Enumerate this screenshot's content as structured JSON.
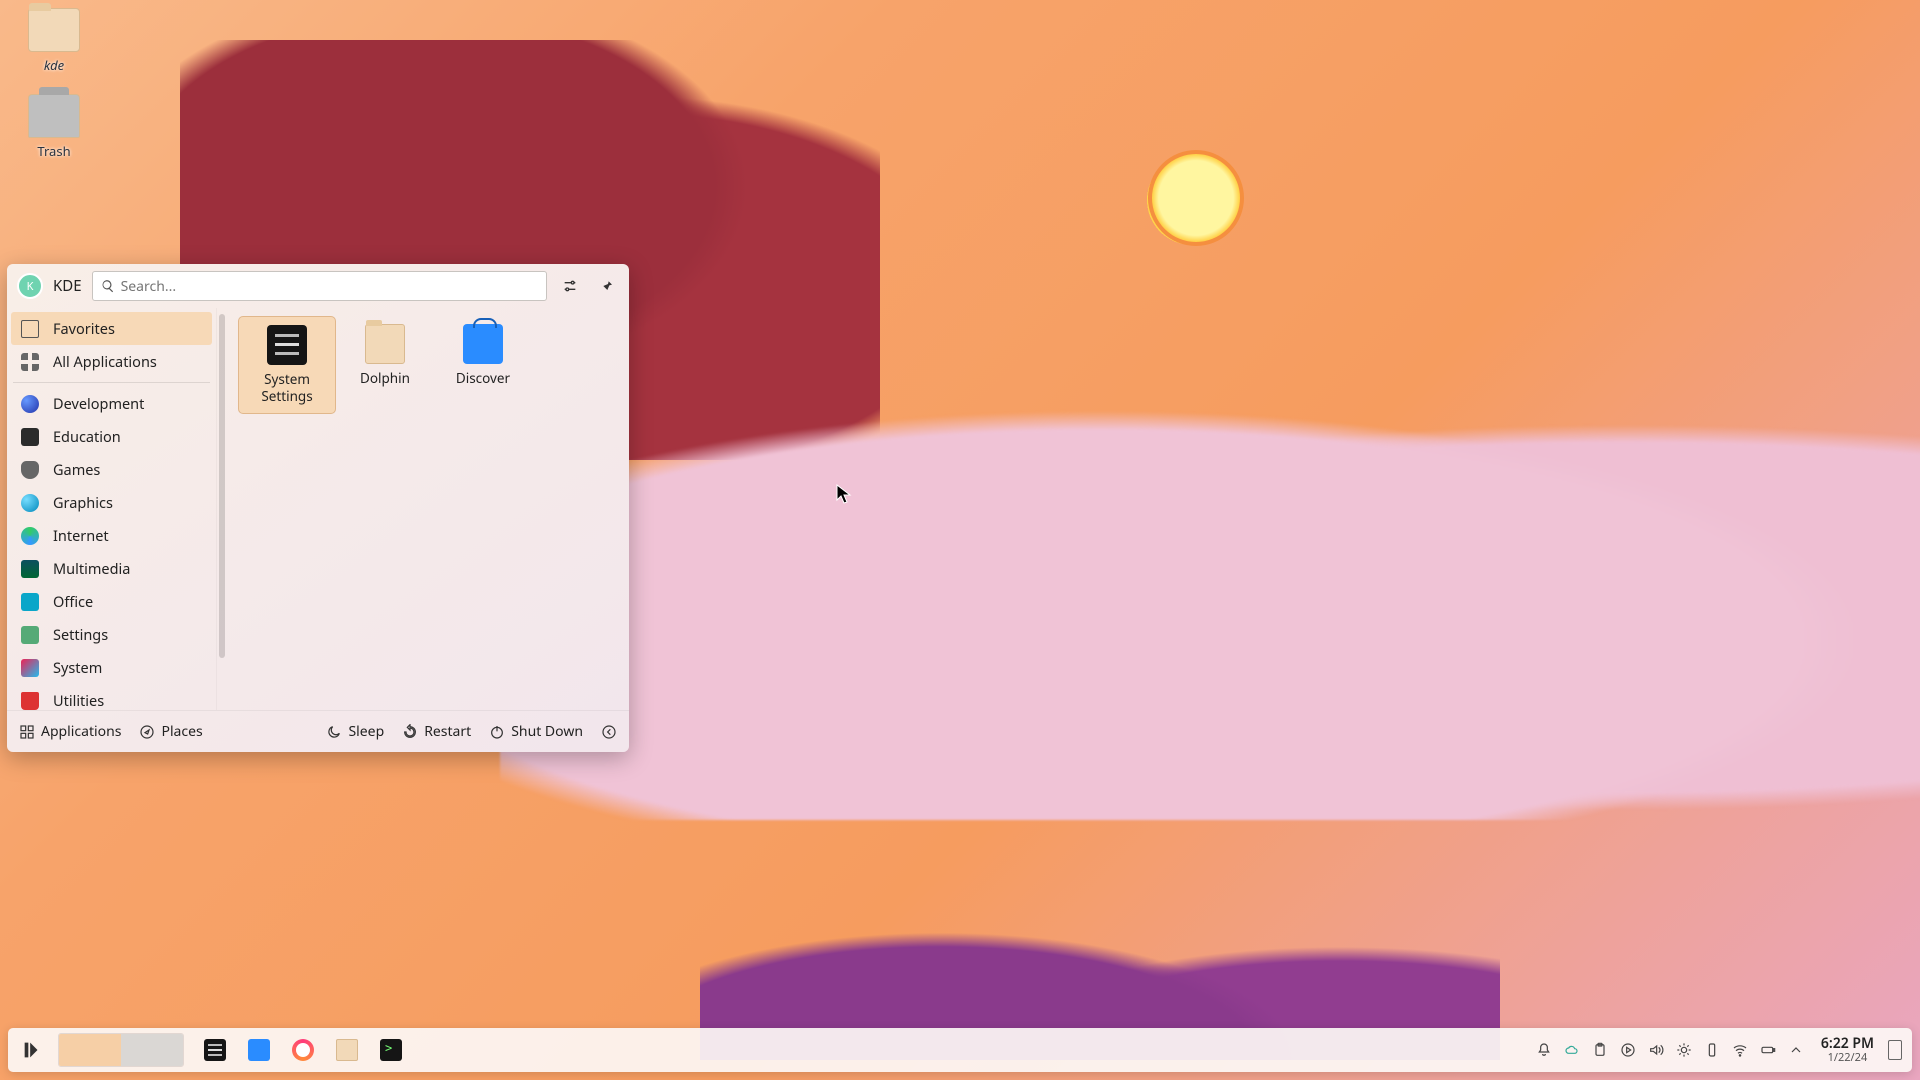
{
  "desktop": {
    "icons": [
      {
        "name": "kde",
        "type": "folder"
      },
      {
        "name": "Trash",
        "type": "trash"
      }
    ]
  },
  "launcher": {
    "user": {
      "initial": "K",
      "name": "KDE"
    },
    "search": {
      "placeholder": "Search..."
    },
    "sidebar_top": [
      {
        "label": "Favorites",
        "icon": "bookmark",
        "selected": true
      },
      {
        "label": "All Applications",
        "icon": "grid"
      }
    ],
    "categories": [
      {
        "label": "Development",
        "icon": "sphere"
      },
      {
        "label": "Education",
        "icon": "edu"
      },
      {
        "label": "Games",
        "icon": "games"
      },
      {
        "label": "Graphics",
        "icon": "gfx"
      },
      {
        "label": "Internet",
        "icon": "net"
      },
      {
        "label": "Multimedia",
        "icon": "mm"
      },
      {
        "label": "Office",
        "icon": "off"
      },
      {
        "label": "Settings",
        "icon": "set"
      },
      {
        "label": "System",
        "icon": "sys"
      },
      {
        "label": "Utilities",
        "icon": "util"
      }
    ],
    "favorites": [
      {
        "label": "System Settings",
        "icon": "settings",
        "selected": true
      },
      {
        "label": "Dolphin",
        "icon": "dolphin"
      },
      {
        "label": "Discover",
        "icon": "discover"
      }
    ],
    "footer": {
      "applications": "Applications",
      "places": "Places",
      "sleep": "Sleep",
      "restart": "Restart",
      "shutdown": "Shut Down"
    }
  },
  "taskbar": {
    "tasks": [
      {
        "icon": "settings"
      },
      {
        "icon": "discover"
      },
      {
        "icon": "ff"
      },
      {
        "icon": "folder"
      },
      {
        "icon": "term"
      }
    ],
    "clock": {
      "time": "6:22 PM",
      "date": "1/22/24"
    }
  }
}
